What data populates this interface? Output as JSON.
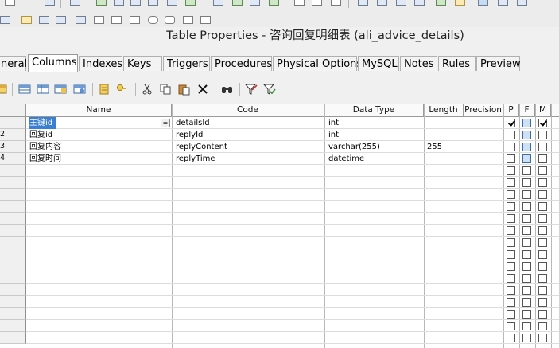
{
  "window": {
    "title": "Table Properties - 咨询回复明细表 (ali_advice_details)"
  },
  "tabs": [
    {
      "label": "neral",
      "active": false
    },
    {
      "label": "Columns",
      "active": true
    },
    {
      "label": "Indexes",
      "active": false
    },
    {
      "label": "Keys",
      "active": false
    },
    {
      "label": "Triggers",
      "active": false
    },
    {
      "label": "Procedures",
      "active": false
    },
    {
      "label": "Physical Options",
      "active": false
    },
    {
      "label": "MySQL",
      "active": false
    },
    {
      "label": "Notes",
      "active": false
    },
    {
      "label": "Rules",
      "active": false
    },
    {
      "label": "Preview",
      "active": false
    }
  ],
  "toolbar": {
    "buttons": [
      "properties-icon",
      "insert-row-icon",
      "add-row-icon",
      "add-columns-icon",
      "replace-column-icon",
      "new-domain-icon",
      "key-icon",
      "cut-icon",
      "copy-icon",
      "paste-icon",
      "delete-icon",
      "find-icon",
      "filter-icon",
      "filter-clear-icon"
    ]
  },
  "grid": {
    "headers": {
      "name": "Name",
      "code": "Code",
      "datatype": "Data Type",
      "length": "Length",
      "precision": "Precision",
      "p": "P",
      "f": "F",
      "m": "M"
    },
    "rows": [
      {
        "num": "",
        "name": "主键id",
        "code": "detailsId",
        "datatype": "int",
        "length": "",
        "p": true,
        "f": false,
        "m": true
      },
      {
        "num": "2",
        "name": "回复id",
        "code": "replyId",
        "datatype": "int",
        "length": "",
        "p": false,
        "f": false,
        "m": false
      },
      {
        "num": "3",
        "name": "回复内容",
        "code": "replyContent",
        "datatype": "varchar(255)",
        "length": "255",
        "p": false,
        "f": false,
        "m": false
      },
      {
        "num": "4",
        "name": "回复时间",
        "code": "replyTime",
        "datatype": "datetime",
        "length": "",
        "p": false,
        "f": false,
        "m": false
      }
    ],
    "dropdown_glyph": "="
  }
}
